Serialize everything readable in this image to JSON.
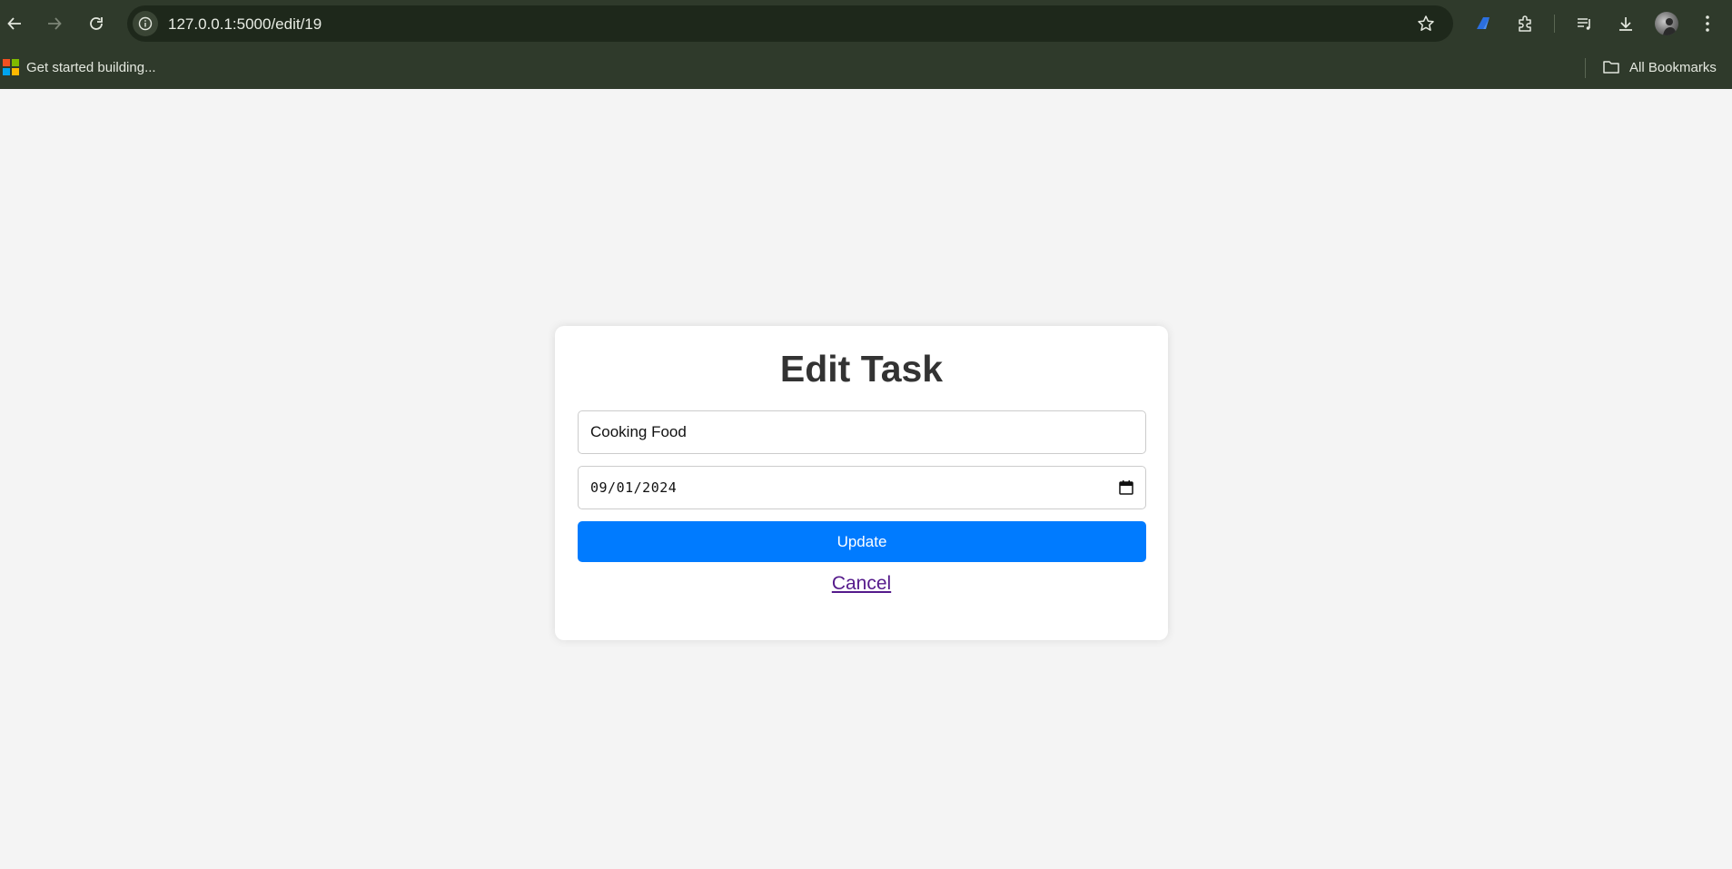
{
  "browser": {
    "url": "127.0.0.1:5000/edit/19",
    "bookmarks": {
      "left_item": "Get started building...",
      "right_item": "All Bookmarks"
    },
    "icons": {
      "back": "back-arrow-icon",
      "forward": "forward-arrow-icon",
      "reload": "reload-icon",
      "site_info": "info-icon",
      "star": "star-icon",
      "copilot": "copilot-icon",
      "extensions": "puzzle-icon",
      "reading_list": "reading-list-icon",
      "downloads": "download-icon",
      "menu": "kebab-menu-icon"
    },
    "colors": {
      "chrome_bg": "#2f3a2b",
      "omnibox_bg": "#1e281b"
    }
  },
  "form": {
    "title": "Edit Task",
    "task_value": "Cooking Food",
    "date_value": "09/01/2024",
    "update_label": "Update",
    "cancel_label": "Cancel"
  },
  "colors": {
    "page_bg": "#f4f4f4",
    "button": "#007bff",
    "link_visited": "#551a8b",
    "heading": "#333333"
  }
}
